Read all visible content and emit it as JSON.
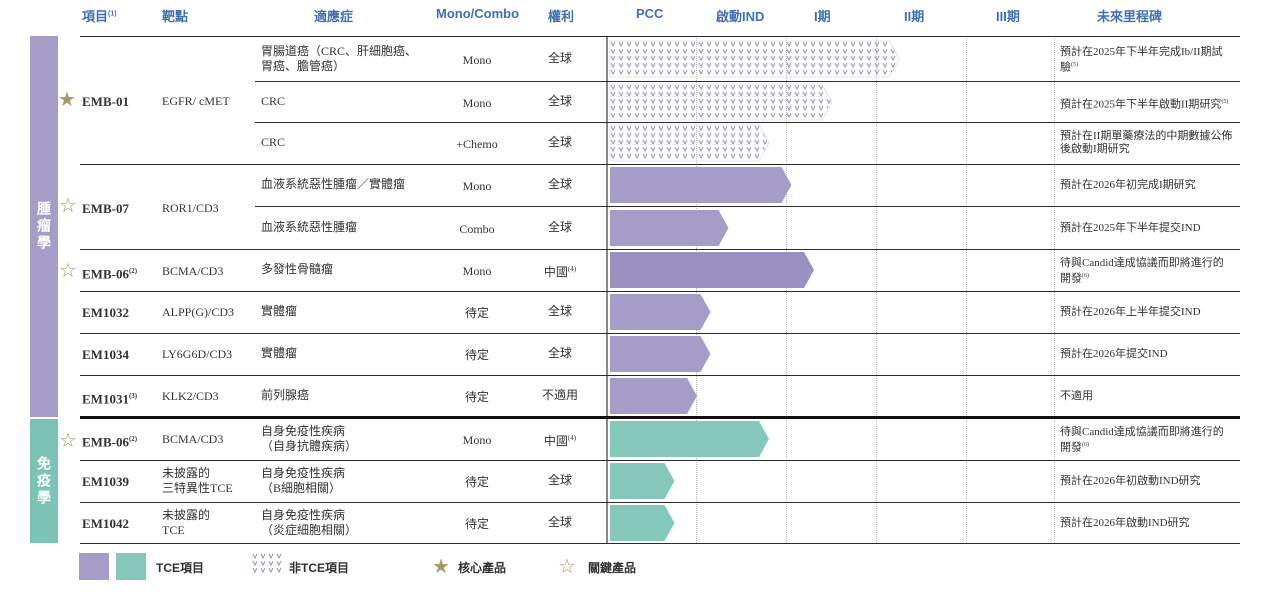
{
  "headers": {
    "project": "項目",
    "project_note": "(1)",
    "target": "靶點",
    "indication": "適應症",
    "mono_combo": "Mono/Combo",
    "rights": "權利",
    "pcc": "PCC",
    "ind": "啟動IND",
    "phase1": "I期",
    "phase2": "II期",
    "phase3": "III期",
    "milestone": "未來里程碑"
  },
  "sections": {
    "oncology": "腫瘤學",
    "immunology": "免疫學"
  },
  "colors": {
    "oncology_band": "#a59cc7",
    "immunology_band": "#7cc3b5",
    "tce_purple": "#a59cc7",
    "tce_purple_dark": "#9b90c2",
    "tce_teal": "#85c8ba",
    "header_blue": "#3f6fb4",
    "star_gold": "#a89967",
    "non_tce_pattern": "#9a92c4"
  },
  "projects": {
    "emb01": {
      "name": "EMB-01",
      "note": "",
      "target": "EGFR/ cMET",
      "star": "core"
    },
    "emb07": {
      "name": "EMB-07",
      "note": "",
      "target": "ROR1/CD3",
      "star": "key"
    },
    "emb06a": {
      "name": "EMB-06",
      "note": "(2)",
      "target": "BCMA/CD3",
      "star": "key"
    },
    "em1032": {
      "name": "EM1032",
      "note": "",
      "target": "ALPP(G)/CD3",
      "star": ""
    },
    "em1034": {
      "name": "EM1034",
      "note": "",
      "target": "LY6G6D/CD3",
      "star": ""
    },
    "em1031": {
      "name": "EM1031",
      "note": "(3)",
      "target": "KLK2/CD3",
      "star": ""
    },
    "emb06b": {
      "name": "EMB-06",
      "note": "(2)",
      "target": "BCMA/CD3",
      "star": "key"
    },
    "em1039": {
      "name": "EM1039",
      "note": "",
      "target_l1": "未披露的",
      "target_l2": "三特異性TCE",
      "star": ""
    },
    "em1042": {
      "name": "EM1042",
      "note": "",
      "target_l1": "未披露的",
      "target_l2": "TCE",
      "star": ""
    }
  },
  "rows": [
    {
      "ind_l1": "胃腸道癌（CRC、肝細胞癌、",
      "ind_l2": "胃癌、膽管癌）",
      "mc": "Mono",
      "rights": "全球",
      "rights_note": "",
      "ms_l1": "預計在2025年下半年完成Ib/II期試",
      "ms_l2": "驗",
      "ms_note": "(5)",
      "progress": 2.55,
      "style": "pattern"
    },
    {
      "ind_l1": "CRC",
      "ind_l2": "",
      "mc": "Mono",
      "rights": "全球",
      "rights_note": "",
      "ms_l1": "預計在2025年下半年啟動II期研究",
      "ms_l2": "",
      "ms_note": "(5)",
      "progress": 1.8,
      "style": "pattern"
    },
    {
      "ind_l1": "CRC",
      "ind_l2": "",
      "mc": "+Chemo",
      "rights": "全球",
      "rights_note": "",
      "ms_l1": "預計在II期單藥療法的中期數據公佈",
      "ms_l2": "後啟動I期研究",
      "ms_note": "",
      "progress": 1.1,
      "style": "pattern"
    },
    {
      "ind_l1": "血液系統惡性腫瘤／實體瘤",
      "ind_l2": "",
      "mc": "Mono",
      "rights": "全球",
      "rights_note": "",
      "ms_l1": "預計在2026年初完成I期研究",
      "ms_l2": "",
      "ms_note": "",
      "progress": 1.35,
      "style": "purple"
    },
    {
      "ind_l1": "血液系統惡性腫瘤",
      "ind_l2": "",
      "mc": "Combo",
      "rights": "全球",
      "rights_note": "",
      "ms_l1": "預計在2025年下半年提交IND",
      "ms_l2": "",
      "ms_note": "",
      "progress": 0.65,
      "style": "purple"
    },
    {
      "ind_l1": "多發性骨髓瘤",
      "ind_l2": "",
      "mc": "Mono",
      "rights": "中國",
      "rights_note": "(4)",
      "ms_l1": "待與Candid達成協議而即將進行的",
      "ms_l2": "開發",
      "ms_note": "(6)",
      "progress": 1.6,
      "style": "purple-dark"
    },
    {
      "ind_l1": "實體瘤",
      "ind_l2": "",
      "mc": "待定",
      "rights": "全球",
      "rights_note": "",
      "ms_l1": "預計在2026年上半年提交IND",
      "ms_l2": "",
      "ms_note": "",
      "progress": 0.45,
      "style": "purple"
    },
    {
      "ind_l1": "實體瘤",
      "ind_l2": "",
      "mc": "待定",
      "rights": "全球",
      "rights_note": "",
      "ms_l1": "預計在2026年提交IND",
      "ms_l2": "",
      "ms_note": "",
      "progress": 0.45,
      "style": "purple"
    },
    {
      "ind_l1": "前列腺癌",
      "ind_l2": "",
      "mc": "待定",
      "rights": "不適用",
      "rights_note": "",
      "ms_l1": "不適用",
      "ms_l2": "",
      "ms_note": "",
      "progress": 0.3,
      "style": "purple"
    },
    {
      "ind_l1": "自身免疫性疾病",
      "ind_l2": "（自身抗體疾病）",
      "mc": "Mono",
      "rights": "中國",
      "rights_note": "(4)",
      "ms_l1": "待與Candid達成協議而即將進行的",
      "ms_l2": "開發",
      "ms_note": "(6)",
      "progress": 1.1,
      "style": "teal"
    },
    {
      "ind_l1": "自身免疫性疾病",
      "ind_l2": "（B細胞相關）",
      "mc": "待定",
      "rights": "全球",
      "rights_note": "",
      "ms_l1": "預計在2026年初啟動IND研究",
      "ms_l2": "",
      "ms_note": "",
      "progress": 0.05,
      "style": "teal"
    },
    {
      "ind_l1": "自身免疫性疾病",
      "ind_l2": "（炎症細胞相關）",
      "mc": "待定",
      "rights": "全球",
      "rights_note": "",
      "ms_l1": "預計在2026年啟動IND研究",
      "ms_l2": "",
      "ms_note": "",
      "progress": 0.05,
      "style": "teal"
    }
  ],
  "legend": {
    "tce": "TCE項目",
    "non_tce": "非TCE項目",
    "core": "核心產品",
    "key": "關鍵產品"
  }
}
